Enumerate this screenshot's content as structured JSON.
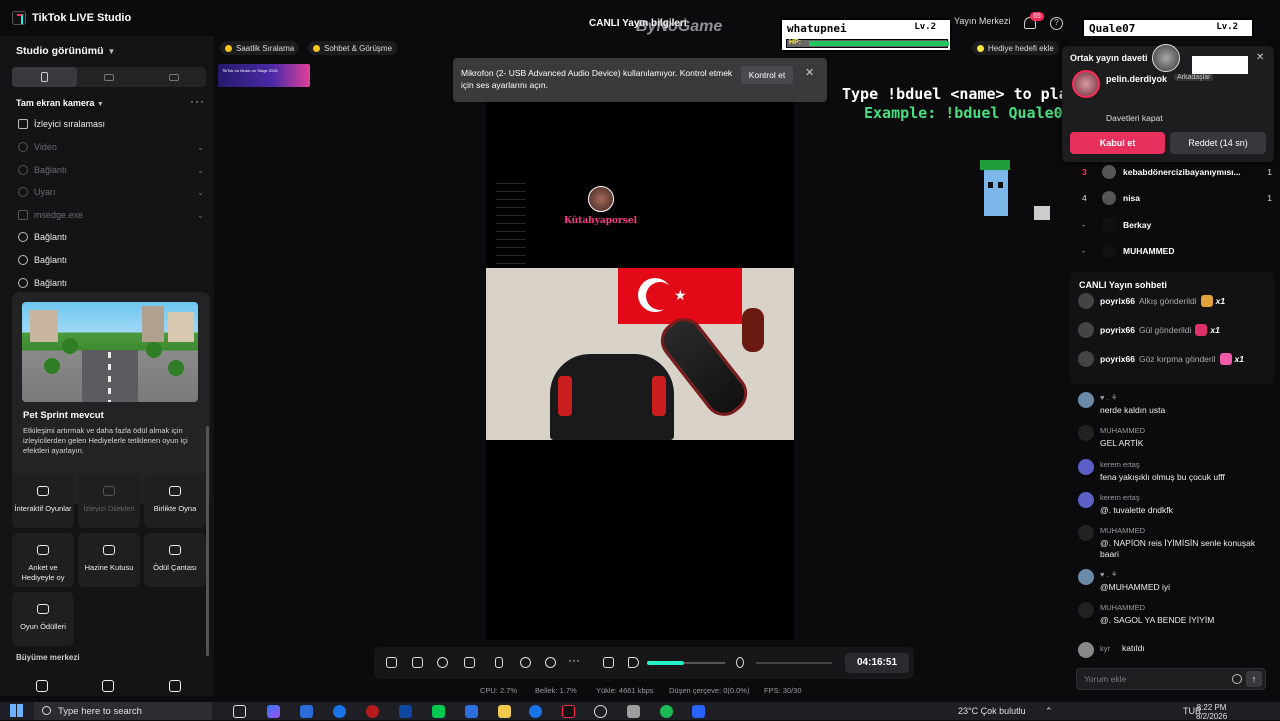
{
  "titlebar": {
    "app_title": "TikTok LIVE Studio",
    "center_title": "CANLI Yayın bilgileri",
    "live_center": "Yayın Merkezi",
    "notif_count": "65"
  },
  "sidebar": {
    "view_label": "Studio görünümü",
    "scene_label": "Tam ekran kamera",
    "sources": [
      {
        "label": "İzleyici sıralaması",
        "enabled": true
      },
      {
        "label": "Video",
        "enabled": false
      },
      {
        "label": "Bağlantı",
        "enabled": false
      },
      {
        "label": "Uyarı",
        "enabled": false
      },
      {
        "label": "msedge.exe",
        "enabled": false
      },
      {
        "label": "Bağlantı",
        "enabled": true
      },
      {
        "label": "Bağlantı",
        "enabled": true
      },
      {
        "label": "Bağlantı",
        "enabled": true
      }
    ],
    "promo": {
      "title": "Pet Sprint mevcut",
      "body": "Etkileşimi artırmak ve daha fazla ödül almak için izleyicilerden gelen Hediyelerle tetiklenen oyun içi efektleri ayarlayın."
    },
    "tools": [
      {
        "label": "İnteraktif Oyunlar",
        "enabled": true
      },
      {
        "label": "İzleyici Dilekleri",
        "enabled": false
      },
      {
        "label": "Birlikte Oyna",
        "enabled": true
      },
      {
        "label": "Anket ve Hediyeyle oy",
        "enabled": true
      },
      {
        "label": "Hazine Kutusu",
        "enabled": true
      },
      {
        "label": "Ödül Çantası",
        "enabled": true
      },
      {
        "label": "Oyun Ödülleri",
        "enabled": true
      }
    ],
    "growth_label": "Büyüme merkezi"
  },
  "stage": {
    "chips": [
      "Saatlik Sıralama",
      "Sohbet & Görüşme"
    ],
    "gift_goal_chip": "Hediye hedefi ekle",
    "banner_text": "TikTok on Music on Stage 2026",
    "toast": {
      "text": "Mikrofon (2- USB Advanced Audio Device) kullanılamıyor. Kontrol etmek için ses ayarlarını açın.",
      "button": "Kontrol et"
    },
    "watermark": "ByNoGame",
    "overlay": {
      "player1": {
        "name": "whatupnei",
        "level": "Lv.2",
        "hp": 1.0
      },
      "player2": {
        "name": "Quale07",
        "level": "Lv.2",
        "hp": 0.4
      },
      "hp_label": "HP:",
      "line1": "Type !bduel <name> to play",
      "line2": "Example: !bduel Quale07"
    },
    "preview_name": "Kütahyaporsel",
    "timer": "04:16:51",
    "volume_level": 0.48,
    "stats": [
      "CPU: 2.7%",
      "Bellek: 1.7%",
      "Yükle: 4661 kbps",
      "Düşen çerçeve: 0(0.0%)",
      "FPS: 30/30"
    ]
  },
  "right_panel": {
    "invite": {
      "title": "Ortak yayın daveti",
      "user": "pelin.derdiyok",
      "tag": "Arkadaşlar",
      "close_option": "Davetleri kapat",
      "accept": "Kabul et",
      "reject": "Reddet (14 sn)"
    },
    "ranking": [
      {
        "rank": "3",
        "name": "kebabdönercizibayanıymısı...",
        "score": "1"
      },
      {
        "rank": "4",
        "name": "nisa",
        "score": "1"
      },
      {
        "rank": "-",
        "name": "Berkay",
        "score": ""
      },
      {
        "rank": "-",
        "name": "MUHAMMED",
        "score": ""
      }
    ],
    "chat_title": "CANLI Yayın sohbeti",
    "gifts": [
      {
        "user": "poyrix66",
        "text": "Alkış gönderildi",
        "count": "x1",
        "color": "#e0a23a"
      },
      {
        "user": "poyrix66",
        "text": "Gül gönderildi",
        "count": "x1",
        "color": "#e0306a"
      },
      {
        "user": "poyrix66",
        "text": "Göz kırpma gönderil",
        "count": "x1",
        "color": "#f05aa8"
      }
    ],
    "messages": [
      {
        "user": "♥ . ⚘",
        "text": "nerde kaldın usta"
      },
      {
        "user": "MUHAMMED",
        "text": "GEL ARTİK"
      },
      {
        "user": "kerem ertaş",
        "text": "fena yakışıklı olmuş bu çocuk ufff"
      },
      {
        "user": "kerem ertaş",
        "text": "@. tuvalette dndkfk"
      },
      {
        "user": "MUHAMMED",
        "text": "@. NAPİON reis İYİMİSİN senle konuşak baari"
      },
      {
        "user": "♥ . ⚘",
        "text": "@MUHAMMED iyi"
      },
      {
        "user": "MUHAMMED",
        "text": "@. SAGOL YA BENDE İYİYİM"
      },
      {
        "user": "kyr",
        "text": "katıldı"
      }
    ],
    "comment_placeholder": "Yorum ekle"
  },
  "taskbar": {
    "search_placeholder": "Type here to search",
    "weather": "23°C  Çok bulutlu",
    "lang": "TUR",
    "time": "8:22 PM",
    "date": "8/2/2026"
  }
}
